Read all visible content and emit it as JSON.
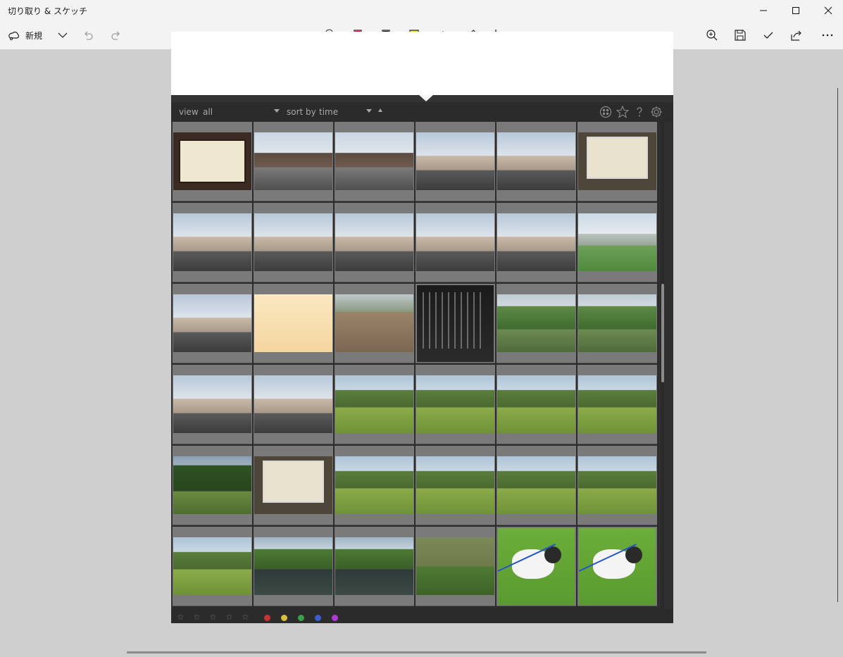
{
  "window": {
    "title": "切り取り & スケッチ"
  },
  "toolbar": {
    "new_label": "新規",
    "tools": [
      "touch-writing-icon",
      "ballpoint-pen-icon",
      "pencil-icon",
      "highlighter-icon",
      "eraser-icon",
      "ruler-icon",
      "crop-icon"
    ],
    "selected_tool": "ballpoint-pen-icon",
    "accent_color": "#0a64c8",
    "pen_color": "#e81123",
    "highlighter_color": "#ffd700"
  },
  "darktable": {
    "view_label": "view",
    "view_value": "all",
    "sort_label": "sort by",
    "sort_value": "time",
    "rating_stars": 5,
    "color_labels": [
      "#c8332f",
      "#d7c13a",
      "#3aa14a",
      "#3a5ed7",
      "#b03ad7"
    ],
    "thumbnail_rows": 6,
    "thumbnail_cols": 6,
    "thumbnails": [
      [
        "sign-board",
        "street",
        "street",
        "building-sky",
        "building-sky",
        "map-sign"
      ],
      [
        "building-sky",
        "building-sky",
        "building-sky",
        "building-sky",
        "building-sky",
        "rice-field"
      ],
      [
        "building-sky",
        "illustrated-map",
        "garden-ruins",
        "monument-text",
        "green-creek",
        "green-creek"
      ],
      [
        "building-sky",
        "building-sky",
        "park-green",
        "park-green",
        "park-green",
        "park-green"
      ],
      [
        "park-dark-green",
        "map-sign",
        "park-green",
        "park-green",
        "park-green",
        "park-green"
      ],
      [
        "park-green",
        "pond",
        "pond",
        "pond-green",
        "dog-grass",
        "dog-grass"
      ]
    ]
  }
}
